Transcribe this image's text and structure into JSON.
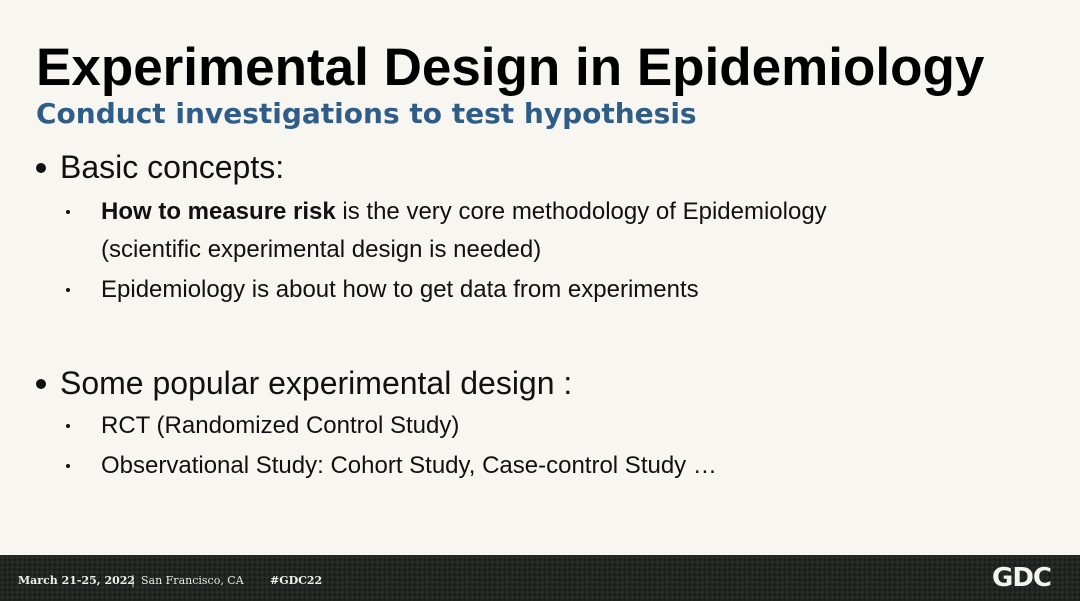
{
  "slide": {
    "title": "Experimental Design in Epidemiology",
    "subtitle": "Conduct investigations to test hypothesis",
    "sections": [
      {
        "heading": "Basic concepts:",
        "items": [
          {
            "bold": "How to measure risk",
            "text": " is the very core methodology of Epidemiology",
            "continuation": "(scientific experimental design is needed)"
          },
          {
            "text": "Epidemiology is about how to get data from experiments"
          }
        ]
      },
      {
        "heading": "Some popular experimental design :",
        "items": [
          {
            "text": "RCT (Randomized Control Study)"
          },
          {
            "text": "Observational Study: Cohort Study, Case-control Study …"
          }
        ]
      }
    ]
  },
  "footer": {
    "date": "March 21-25, 2022",
    "separator": "|",
    "location": "San Francisco, CA",
    "hashtag": "#GDC22",
    "logo_text": "GDC"
  },
  "colors": {
    "background": "#f7f6f0",
    "subtitle": "#2f5d87",
    "footer_bg": "#222521"
  }
}
